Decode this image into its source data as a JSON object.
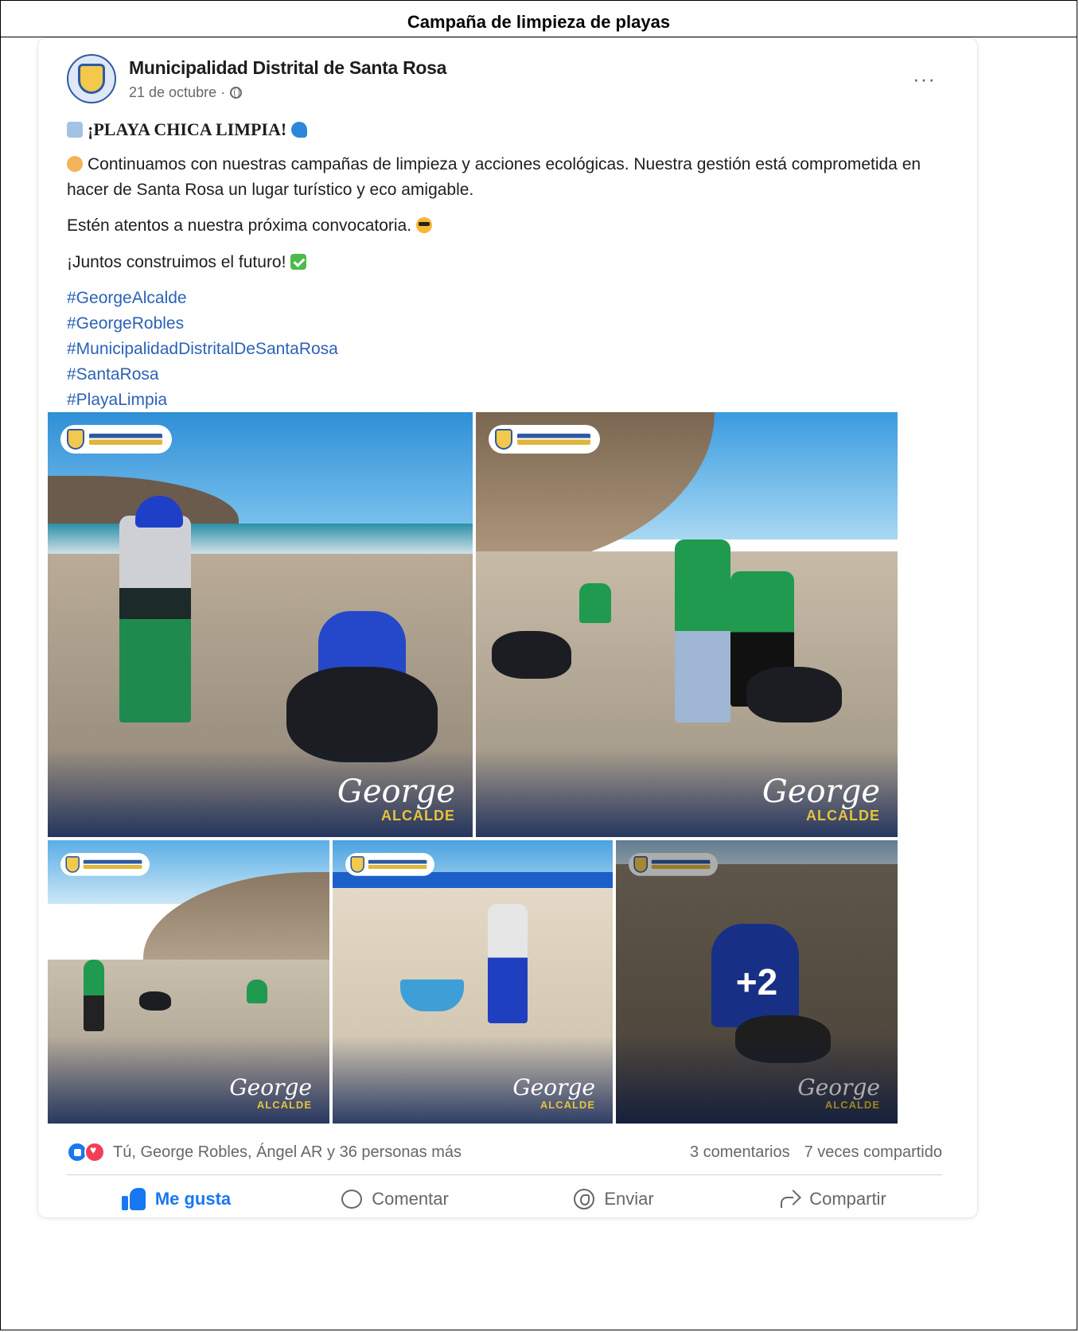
{
  "document": {
    "title": "Campaña de limpieza de playas"
  },
  "post": {
    "page_name": "Municipalidad Distrital de Santa Rosa",
    "date": "21 de octubre ·",
    "audience_icon": "globe-icon",
    "more_icon": "more-options-icon",
    "more_label": "···",
    "headline": "¡PLAYA CHICA LIMPIA!",
    "paragraph_1": "Continuamos con nuestras campañas de limpieza y acciones ecológicas. Nuestra gestión está comprometida en hacer de Santa Rosa un lugar turístico y eco amigable.",
    "paragraph_2": "Estén atentos a nuestra próxima convocatoria.",
    "paragraph_3": "¡Juntos construimos el futuro!",
    "hashtags": [
      "#GeorgeAlcalde",
      "#GeorgeRobles",
      "#MunicipalidadDistritalDeSantaRosa",
      "#SantaRosa",
      "#PlayaLimpia"
    ],
    "photo_signature": {
      "script": "George",
      "title": "ALCALDE"
    },
    "extra_photos_label": "+2"
  },
  "stats": {
    "reactions_text": "Tú, George Robles, Ángel AR y 36 personas más",
    "comments": "3 comentarios",
    "shares": "7 veces compartido"
  },
  "actions": {
    "like": "Me gusta",
    "comment": "Comentar",
    "send": "Enviar",
    "share": "Compartir"
  },
  "colors": {
    "brand_blue": "#1877f2",
    "hashtag_blue": "#2b62b6",
    "love_red": "#f33e58",
    "muted_text": "#65676b"
  }
}
